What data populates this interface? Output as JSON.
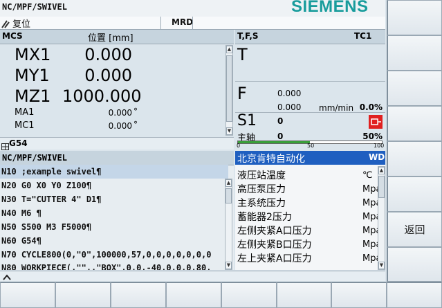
{
  "header": {
    "path": "NC/MPF/SWIVEL",
    "brand": "SIEMENS",
    "mode_icon": "reset-icon",
    "status_text": "复位",
    "mode": "MRD"
  },
  "position": {
    "title_left": "MCS",
    "title_center": "位置 [mm]",
    "axes": [
      {
        "name": "MX1",
        "value": "0.000",
        "unit": ""
      },
      {
        "name": "MY1",
        "value": "0.000",
        "unit": ""
      },
      {
        "name": "MZ1",
        "value": "1000.000",
        "unit": ""
      }
    ],
    "small_axes": [
      {
        "name": "MA1",
        "value": "0.000",
        "unit": "°"
      },
      {
        "name": "MC1",
        "value": "0.000",
        "unit": "°"
      }
    ],
    "frame_icon": "frame-icon",
    "frame": "G54"
  },
  "tfs": {
    "title": "T,F,S",
    "channel": "TC1",
    "t_label": "T",
    "f_label": "F",
    "f_value1": "0.000",
    "f_value2": "0.000",
    "f_unit": "mm/min",
    "f_percent": "0.0%",
    "s_label": "S1",
    "s_value1": "0",
    "s_value2": "0",
    "spindle_label": "主轴",
    "s_percent": "50%",
    "spindle_icon": "spindle-stop-icon",
    "spindle_load_fraction": 0.5,
    "scale": [
      "0",
      "50",
      "100"
    ]
  },
  "program": {
    "title": "NC/MPF/SWIVEL",
    "lines": [
      "N10 ;example swivel¶",
      "N20 G0 X0 Y0 Z100¶",
      "N30 T=\"CUTTER 4\" D1¶",
      "N40 M6 ¶",
      "N50 S500 M3 F5000¶",
      "N60 G54¶",
      "N70 CYCLE800(0,\"0\",100000,57,0,0,0,0,0,0,0",
      "N80 WORKPIECE(,\"\",,\"BOX\",0,0,-40,0,0,0,80,"
    ],
    "selected_index": 0
  },
  "diag": {
    "title": "北京肯特自动化",
    "title_right": "WD",
    "items": [
      {
        "label": "液压站温度",
        "unit": "℃"
      },
      {
        "label": "高压泵压力",
        "unit": "Mpa"
      },
      {
        "label": "主系统压力",
        "unit": "Mpa"
      },
      {
        "label": "蓄能器2压力",
        "unit": "Mpa"
      },
      {
        "label": "左侧夹紧A口压力",
        "unit": "Mpa"
      },
      {
        "label": "左侧夹紧B口压力",
        "unit": "Mpa"
      },
      {
        "label": "左上夹紧A口压力",
        "unit": "Mpa"
      }
    ]
  },
  "softkeys": {
    "return": "返回",
    "expand_icon": "chevron-up-icon"
  },
  "colors": {
    "background": "#dbe5ec",
    "title_bar": "#c6d4de",
    "selection": "#1f5fc0",
    "brand": "#189c9c",
    "alarm": "#e02020"
  }
}
